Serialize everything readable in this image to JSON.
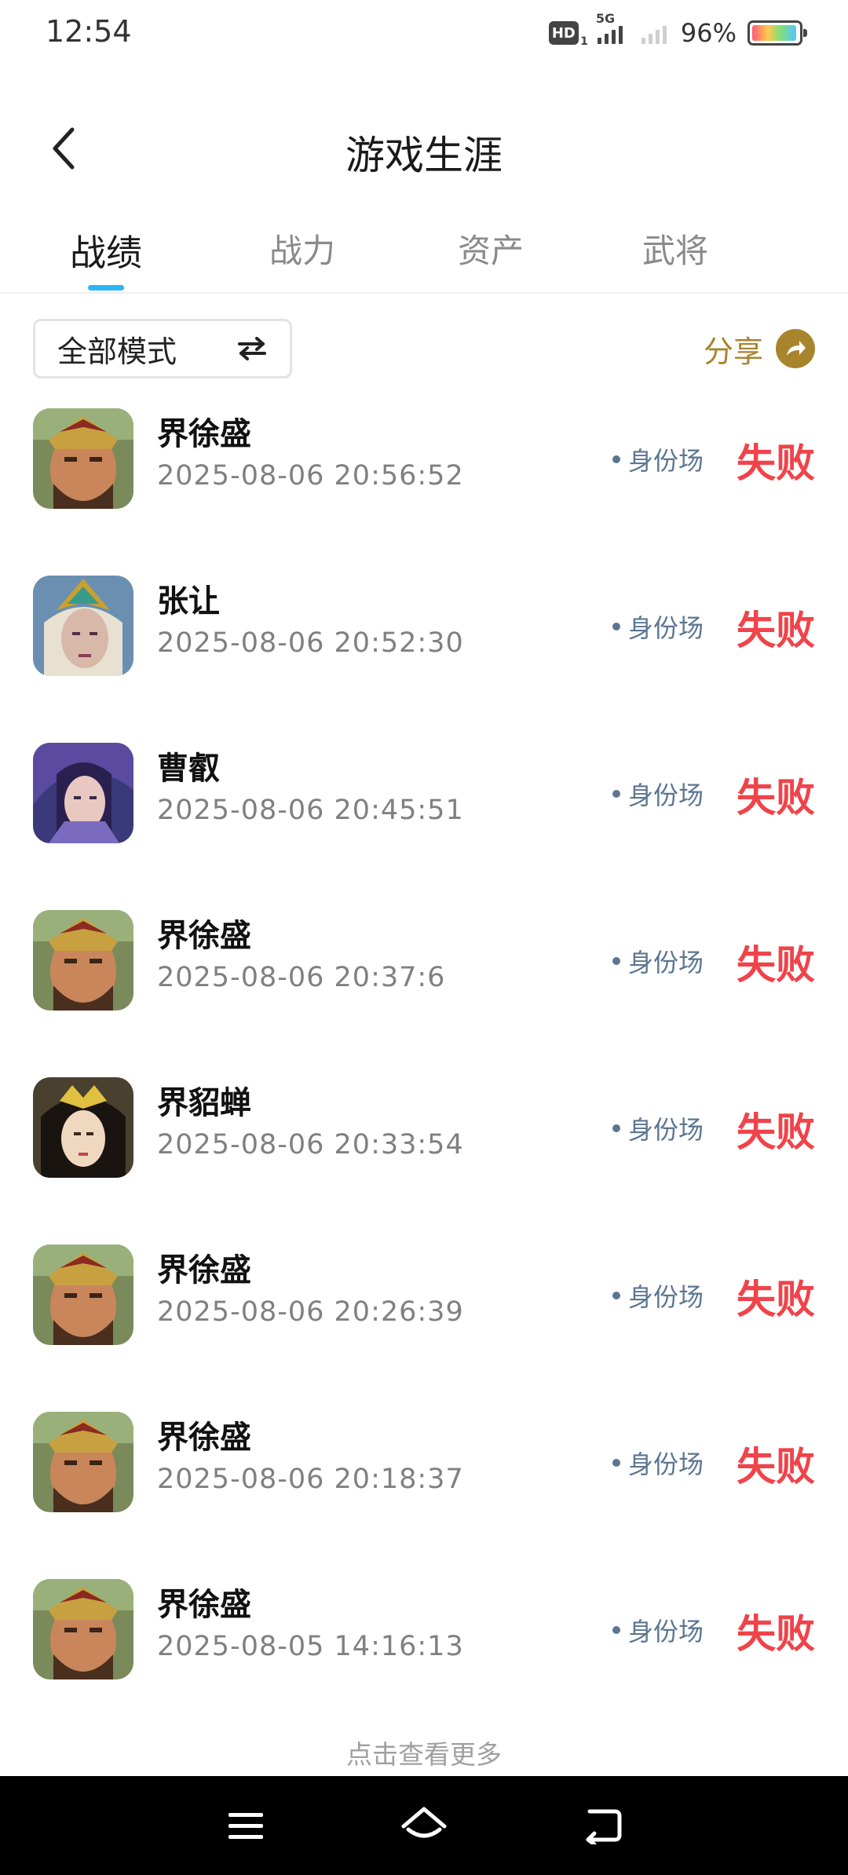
{
  "status_bar": {
    "time": "12:54",
    "hd": "HD",
    "hd_sub": "1",
    "net": "5G",
    "battery_pct": "96%"
  },
  "header": {
    "title": "游戏生涯"
  },
  "tabs": [
    {
      "label": "战绩",
      "active": true
    },
    {
      "label": "战力",
      "active": false
    },
    {
      "label": "资产",
      "active": false
    },
    {
      "label": "武将",
      "active": false
    }
  ],
  "filter": {
    "mode_label": "全部模式",
    "share_label": "分享"
  },
  "records": [
    {
      "hero": "界徐盛",
      "time": "2025-08-06 20:56:52",
      "mode": "身份场",
      "result": "失败",
      "avatar": "xusheng"
    },
    {
      "hero": "张让",
      "time": "2025-08-06 20:52:30",
      "mode": "身份场",
      "result": "失败",
      "avatar": "zhangrang"
    },
    {
      "hero": "曹叡",
      "time": "2025-08-06 20:45:51",
      "mode": "身份场",
      "result": "失败",
      "avatar": "caorui"
    },
    {
      "hero": "界徐盛",
      "time": "2025-08-06 20:37:6",
      "mode": "身份场",
      "result": "失败",
      "avatar": "xusheng"
    },
    {
      "hero": "界貂蝉",
      "time": "2025-08-06 20:33:54",
      "mode": "身份场",
      "result": "失败",
      "avatar": "diaochan"
    },
    {
      "hero": "界徐盛",
      "time": "2025-08-06 20:26:39",
      "mode": "身份场",
      "result": "失败",
      "avatar": "xusheng"
    },
    {
      "hero": "界徐盛",
      "time": "2025-08-06 20:18:37",
      "mode": "身份场",
      "result": "失败",
      "avatar": "xusheng"
    },
    {
      "hero": "界徐盛",
      "time": "2025-08-05 14:16:13",
      "mode": "身份场",
      "result": "失败",
      "avatar": "xusheng"
    }
  ],
  "load_more": "点击查看更多",
  "colors": {
    "accent": "#2cb5f5",
    "share": "#a8842d",
    "defeat": "#f0434a",
    "mode": "#5c7691"
  }
}
